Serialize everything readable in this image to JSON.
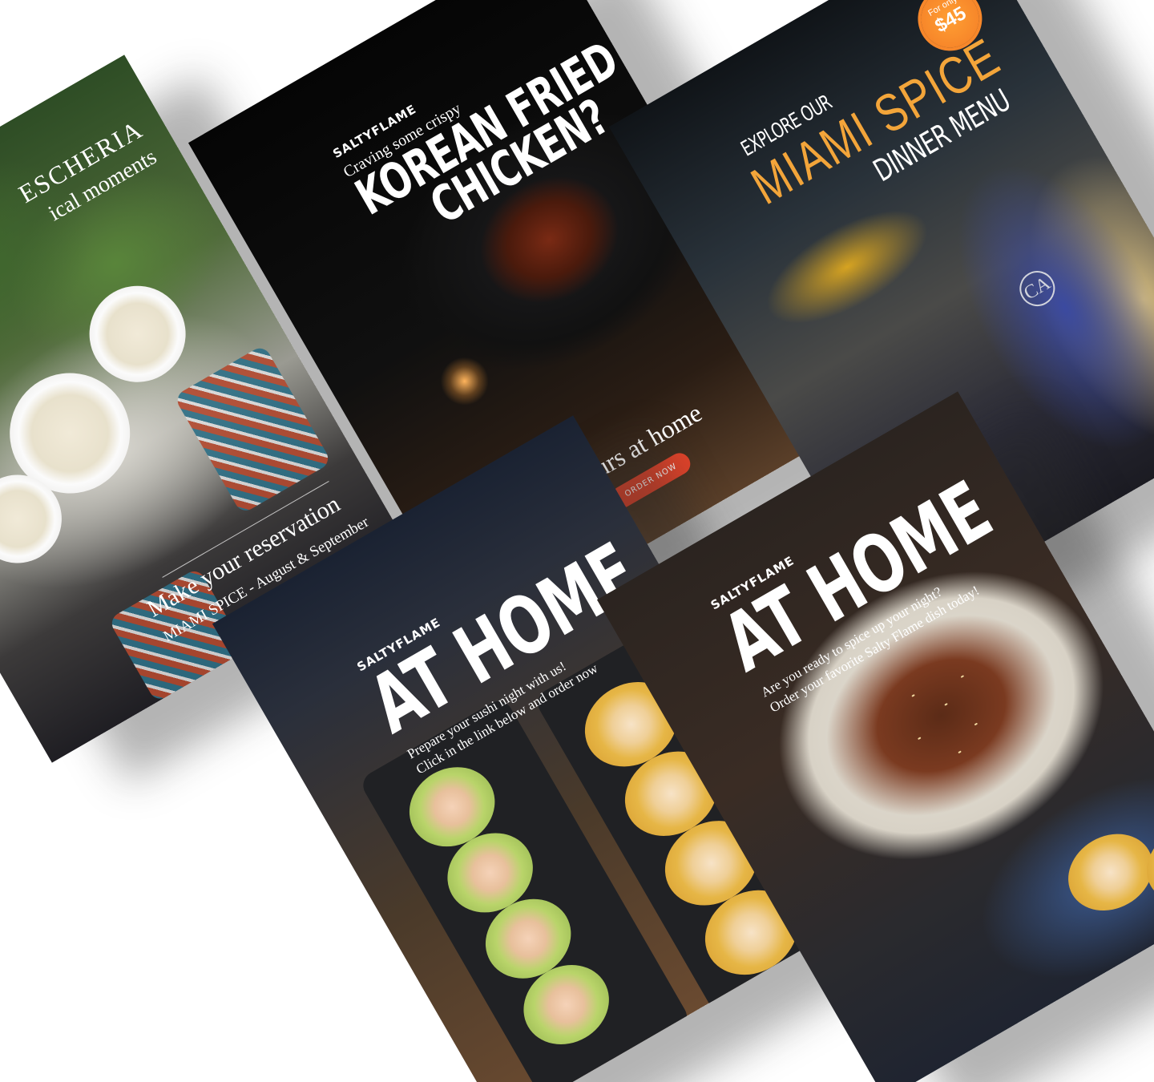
{
  "cards": {
    "pescheria": {
      "headline_1": "ESCHERIA",
      "headline_2": "ical moments",
      "reservation": "Make your reservation",
      "dates": "MIAMI SPICE - August & September"
    },
    "korean": {
      "brand": "SALTYFLAME",
      "kicker": "Craving some crispy",
      "title_1": "KOREAN FRIED",
      "title_2": "CHICKEN?",
      "cta_text": "Get yours at home",
      "cta_button": "ORDER NOW"
    },
    "miami": {
      "explore": "EXPLORE OUR",
      "miami_spice": "MIAMI SPICE",
      "dinner_menu": "DINNER MENU",
      "badge_top": "For only",
      "badge_price": "$45",
      "napkin_logo": "CA"
    },
    "sushi": {
      "brand": "SALTYFLAME",
      "title": "AT HOME",
      "line_1": "Prepare your sushi night with us!",
      "line_2": "Click in the link below and order now"
    },
    "beef": {
      "brand": "SALTYFLAME",
      "title": "AT HOME",
      "line_1": "Are you ready to spice up your night?",
      "line_2": "Order your favorite Salty Flame dish today!"
    }
  },
  "colors": {
    "page_background": "#ffffff",
    "order_button": "#e0432a",
    "price_badge": "#f7872a",
    "miami_script": "#f3a53a"
  }
}
